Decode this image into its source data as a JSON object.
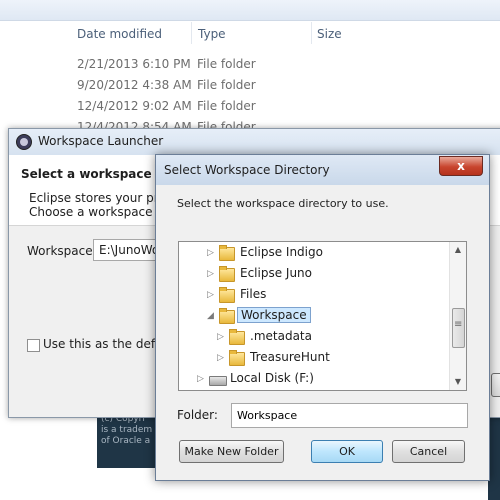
{
  "explorer": {
    "columns": [
      "Date modified",
      "Type",
      "Size"
    ],
    "rows": [
      {
        "date": "2/21/2013 6:10 PM",
        "type": "File folder"
      },
      {
        "date": "9/20/2012 4:38 AM",
        "type": "File folder"
      },
      {
        "date": "12/4/2012 9:02 AM",
        "type": "File folder"
      },
      {
        "date": "12/4/2012 8:54 AM",
        "type": "File folder"
      }
    ]
  },
  "splash": {
    "line1": "(c) Copyri",
    "line2": "is a tradem",
    "line3": "of Oracle a"
  },
  "launcher": {
    "title": "Workspace Launcher",
    "heading": "Select a workspace",
    "desc_line1": "Eclipse stores your proje",
    "desc_line2": "Choose a workspace fol",
    "workspace_label": "Workspace:",
    "workspace_value": "E:\\JunoWo",
    "default_checkbox_label": "Use this as the default",
    "default_checked": false
  },
  "dialog": {
    "title": "Select Workspace Directory",
    "close_label": "x",
    "message": "Select the workspace directory to use.",
    "tree": [
      {
        "label": "Eclipse Indigo",
        "expander": "▷",
        "icon": "folder-icon"
      },
      {
        "label": "Eclipse Juno",
        "expander": "▷",
        "icon": "folder-icon"
      },
      {
        "label": "Files",
        "expander": "▷",
        "icon": "folder-icon"
      },
      {
        "label": "Workspace",
        "expander": "◢",
        "icon": "folder-icon",
        "selected": true
      },
      {
        "label": ".metadata",
        "expander": "▷",
        "icon": "folder-icon"
      },
      {
        "label": "TreasureHunt",
        "expander": "▷",
        "icon": "folder-icon"
      },
      {
        "label": "Local Disk (F:)",
        "expander": "▷",
        "icon": "drive-icon"
      }
    ],
    "folder_label": "Folder:",
    "folder_value": "Workspace",
    "buttons": {
      "new_folder": "Make New Folder",
      "ok": "OK",
      "cancel": "Cancel"
    }
  }
}
